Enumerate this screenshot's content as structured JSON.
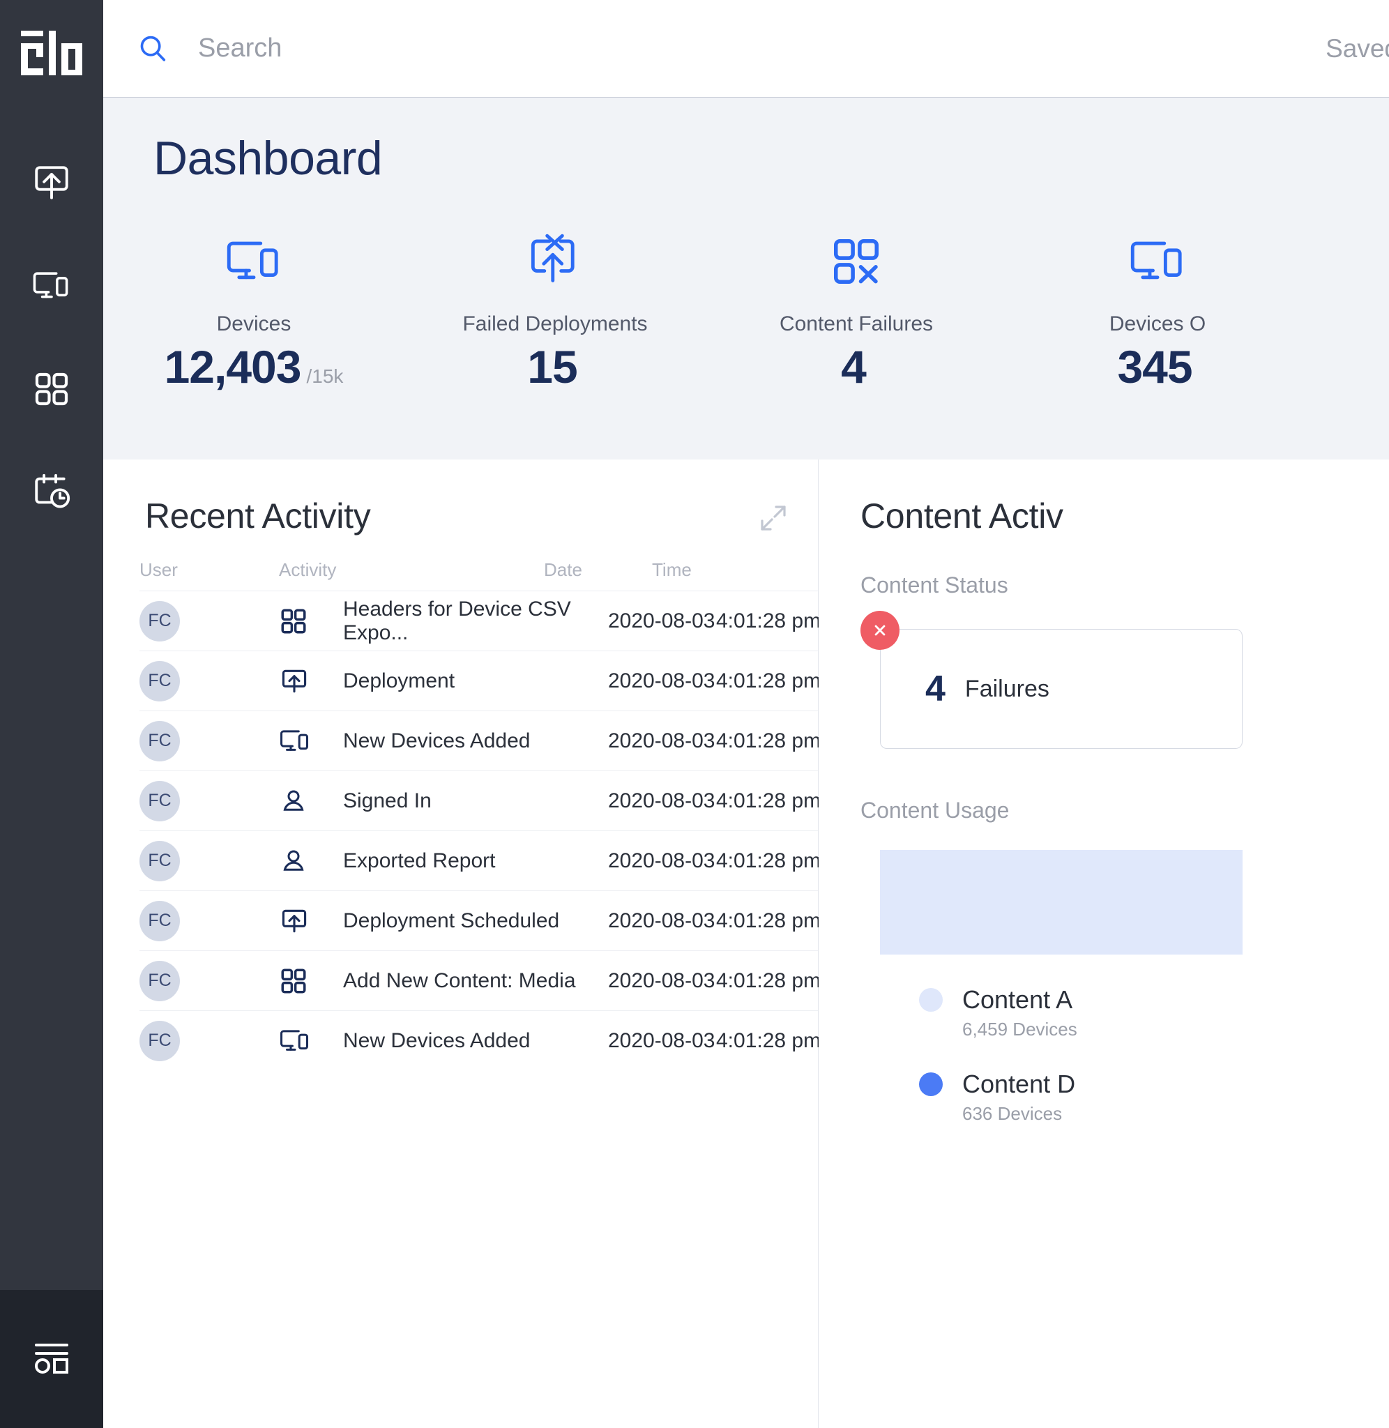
{
  "brand": {
    "logo_text": "elo"
  },
  "sidebar": {
    "items": [
      {
        "name": "deploy",
        "icon": "deploy-icon"
      },
      {
        "name": "devices",
        "icon": "devices-icon"
      },
      {
        "name": "content",
        "icon": "grid-icon"
      },
      {
        "name": "schedule",
        "icon": "calendar-clock-icon"
      }
    ],
    "bottom_item": {
      "name": "forms",
      "icon": "list-shapes-icon"
    }
  },
  "topbar": {
    "search_placeholder": "Search",
    "search_value": "",
    "saved_label": "Saved"
  },
  "header": {
    "title": "Dashboard"
  },
  "stats": [
    {
      "label": "Devices",
      "value": "12,403",
      "suffix": "/15k",
      "icon": "devices-icon"
    },
    {
      "label": "Failed Deployments",
      "value": "15",
      "suffix": "",
      "icon": "failed-deploy-icon"
    },
    {
      "label": "Content Failures",
      "value": "4",
      "suffix": "",
      "icon": "content-failure-icon"
    },
    {
      "label": "Devices O",
      "value": "345",
      "suffix": "",
      "icon": "devices-icon"
    }
  ],
  "recent_activity": {
    "title": "Recent Activity",
    "columns": [
      "User",
      "Activity",
      "Date",
      "Time"
    ],
    "rows": [
      {
        "user": "FC",
        "icon": "grid-icon",
        "activity": "Headers for Device CSV Expo...",
        "date": "2020-08-03",
        "time": "4:01:28 pm"
      },
      {
        "user": "FC",
        "icon": "deploy-icon",
        "activity": "Deployment",
        "date": "2020-08-03",
        "time": "4:01:28 pm"
      },
      {
        "user": "FC",
        "icon": "devices-icon",
        "activity": "New Devices Added",
        "date": "2020-08-03",
        "time": "4:01:28 pm"
      },
      {
        "user": "FC",
        "icon": "person-icon",
        "activity": "Signed In",
        "date": "2020-08-03",
        "time": "4:01:28 pm"
      },
      {
        "user": "FC",
        "icon": "person-icon",
        "activity": "Exported Report",
        "date": "2020-08-03",
        "time": "4:01:28 pm"
      },
      {
        "user": "FC",
        "icon": "deploy-icon",
        "activity": "Deployment Scheduled",
        "date": "2020-08-03",
        "time": "4:01:28 pm"
      },
      {
        "user": "FC",
        "icon": "grid-icon",
        "activity": "Add New Content: Media",
        "date": "2020-08-03",
        "time": "4:01:28 pm"
      },
      {
        "user": "FC",
        "icon": "devices-icon",
        "activity": "New Devices Added",
        "date": "2020-08-03",
        "time": "4:01:28 pm"
      }
    ]
  },
  "content_activity": {
    "title": "Content Activ",
    "status_label": "Content Status",
    "status_count": "4",
    "status_text": "Failures",
    "usage_label": "Content Usage",
    "legend": [
      {
        "name": "Content A",
        "sub": "6,459 Devices",
        "color": "#dfe7fb"
      },
      {
        "name": "Content D",
        "sub": "636 Devices",
        "color": "#4b7bf5"
      }
    ]
  },
  "chart_data": {
    "type": "bar",
    "title": "Content Usage",
    "categories": [
      "Content A",
      "Content D"
    ],
    "values": [
      6459,
      636
    ],
    "xlabel": "",
    "ylabel": "Devices",
    "legend_position": "bottom",
    "grid": false
  },
  "colors": {
    "sidebar_bg": "#32363f",
    "sidebar_bottom_bg": "#20242c",
    "band_bg": "#f1f3f7",
    "accent_blue": "#2c6bf5",
    "navy": "#1b2d59",
    "muted": "#9a9ea8",
    "danger": "#ef5c64"
  }
}
